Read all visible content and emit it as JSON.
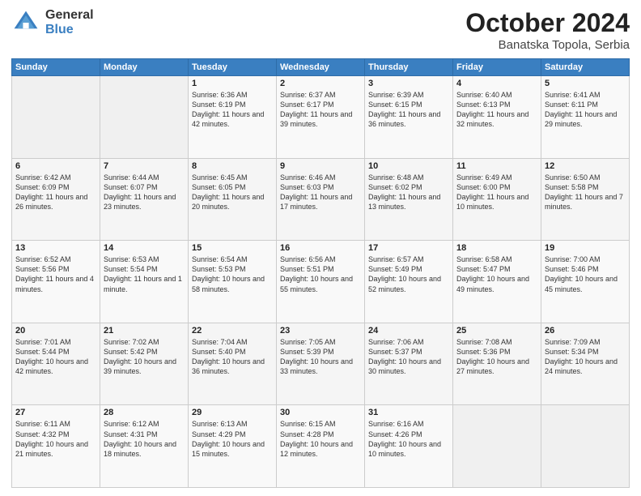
{
  "header": {
    "logo_general": "General",
    "logo_blue": "Blue",
    "title": "October 2024",
    "location": "Banatska Topola, Serbia"
  },
  "days_of_week": [
    "Sunday",
    "Monday",
    "Tuesday",
    "Wednesday",
    "Thursday",
    "Friday",
    "Saturday"
  ],
  "weeks": [
    [
      {
        "day": "",
        "empty": true
      },
      {
        "day": "",
        "empty": true
      },
      {
        "day": "1",
        "sunrise": "Sunrise: 6:36 AM",
        "sunset": "Sunset: 6:19 PM",
        "daylight": "Daylight: 11 hours and 42 minutes."
      },
      {
        "day": "2",
        "sunrise": "Sunrise: 6:37 AM",
        "sunset": "Sunset: 6:17 PM",
        "daylight": "Daylight: 11 hours and 39 minutes."
      },
      {
        "day": "3",
        "sunrise": "Sunrise: 6:39 AM",
        "sunset": "Sunset: 6:15 PM",
        "daylight": "Daylight: 11 hours and 36 minutes."
      },
      {
        "day": "4",
        "sunrise": "Sunrise: 6:40 AM",
        "sunset": "Sunset: 6:13 PM",
        "daylight": "Daylight: 11 hours and 32 minutes."
      },
      {
        "day": "5",
        "sunrise": "Sunrise: 6:41 AM",
        "sunset": "Sunset: 6:11 PM",
        "daylight": "Daylight: 11 hours and 29 minutes."
      }
    ],
    [
      {
        "day": "6",
        "sunrise": "Sunrise: 6:42 AM",
        "sunset": "Sunset: 6:09 PM",
        "daylight": "Daylight: 11 hours and 26 minutes."
      },
      {
        "day": "7",
        "sunrise": "Sunrise: 6:44 AM",
        "sunset": "Sunset: 6:07 PM",
        "daylight": "Daylight: 11 hours and 23 minutes."
      },
      {
        "day": "8",
        "sunrise": "Sunrise: 6:45 AM",
        "sunset": "Sunset: 6:05 PM",
        "daylight": "Daylight: 11 hours and 20 minutes."
      },
      {
        "day": "9",
        "sunrise": "Sunrise: 6:46 AM",
        "sunset": "Sunset: 6:03 PM",
        "daylight": "Daylight: 11 hours and 17 minutes."
      },
      {
        "day": "10",
        "sunrise": "Sunrise: 6:48 AM",
        "sunset": "Sunset: 6:02 PM",
        "daylight": "Daylight: 11 hours and 13 minutes."
      },
      {
        "day": "11",
        "sunrise": "Sunrise: 6:49 AM",
        "sunset": "Sunset: 6:00 PM",
        "daylight": "Daylight: 11 hours and 10 minutes."
      },
      {
        "day": "12",
        "sunrise": "Sunrise: 6:50 AM",
        "sunset": "Sunset: 5:58 PM",
        "daylight": "Daylight: 11 hours and 7 minutes."
      }
    ],
    [
      {
        "day": "13",
        "sunrise": "Sunrise: 6:52 AM",
        "sunset": "Sunset: 5:56 PM",
        "daylight": "Daylight: 11 hours and 4 minutes."
      },
      {
        "day": "14",
        "sunrise": "Sunrise: 6:53 AM",
        "sunset": "Sunset: 5:54 PM",
        "daylight": "Daylight: 11 hours and 1 minute."
      },
      {
        "day": "15",
        "sunrise": "Sunrise: 6:54 AM",
        "sunset": "Sunset: 5:53 PM",
        "daylight": "Daylight: 10 hours and 58 minutes."
      },
      {
        "day": "16",
        "sunrise": "Sunrise: 6:56 AM",
        "sunset": "Sunset: 5:51 PM",
        "daylight": "Daylight: 10 hours and 55 minutes."
      },
      {
        "day": "17",
        "sunrise": "Sunrise: 6:57 AM",
        "sunset": "Sunset: 5:49 PM",
        "daylight": "Daylight: 10 hours and 52 minutes."
      },
      {
        "day": "18",
        "sunrise": "Sunrise: 6:58 AM",
        "sunset": "Sunset: 5:47 PM",
        "daylight": "Daylight: 10 hours and 49 minutes."
      },
      {
        "day": "19",
        "sunrise": "Sunrise: 7:00 AM",
        "sunset": "Sunset: 5:46 PM",
        "daylight": "Daylight: 10 hours and 45 minutes."
      }
    ],
    [
      {
        "day": "20",
        "sunrise": "Sunrise: 7:01 AM",
        "sunset": "Sunset: 5:44 PM",
        "daylight": "Daylight: 10 hours and 42 minutes."
      },
      {
        "day": "21",
        "sunrise": "Sunrise: 7:02 AM",
        "sunset": "Sunset: 5:42 PM",
        "daylight": "Daylight: 10 hours and 39 minutes."
      },
      {
        "day": "22",
        "sunrise": "Sunrise: 7:04 AM",
        "sunset": "Sunset: 5:40 PM",
        "daylight": "Daylight: 10 hours and 36 minutes."
      },
      {
        "day": "23",
        "sunrise": "Sunrise: 7:05 AM",
        "sunset": "Sunset: 5:39 PM",
        "daylight": "Daylight: 10 hours and 33 minutes."
      },
      {
        "day": "24",
        "sunrise": "Sunrise: 7:06 AM",
        "sunset": "Sunset: 5:37 PM",
        "daylight": "Daylight: 10 hours and 30 minutes."
      },
      {
        "day": "25",
        "sunrise": "Sunrise: 7:08 AM",
        "sunset": "Sunset: 5:36 PM",
        "daylight": "Daylight: 10 hours and 27 minutes."
      },
      {
        "day": "26",
        "sunrise": "Sunrise: 7:09 AM",
        "sunset": "Sunset: 5:34 PM",
        "daylight": "Daylight: 10 hours and 24 minutes."
      }
    ],
    [
      {
        "day": "27",
        "sunrise": "Sunrise: 6:11 AM",
        "sunset": "Sunset: 4:32 PM",
        "daylight": "Daylight: 10 hours and 21 minutes."
      },
      {
        "day": "28",
        "sunrise": "Sunrise: 6:12 AM",
        "sunset": "Sunset: 4:31 PM",
        "daylight": "Daylight: 10 hours and 18 minutes."
      },
      {
        "day": "29",
        "sunrise": "Sunrise: 6:13 AM",
        "sunset": "Sunset: 4:29 PM",
        "daylight": "Daylight: 10 hours and 15 minutes."
      },
      {
        "day": "30",
        "sunrise": "Sunrise: 6:15 AM",
        "sunset": "Sunset: 4:28 PM",
        "daylight": "Daylight: 10 hours and 12 minutes."
      },
      {
        "day": "31",
        "sunrise": "Sunrise: 6:16 AM",
        "sunset": "Sunset: 4:26 PM",
        "daylight": "Daylight: 10 hours and 10 minutes."
      },
      {
        "day": "",
        "empty": true
      },
      {
        "day": "",
        "empty": true
      }
    ]
  ]
}
